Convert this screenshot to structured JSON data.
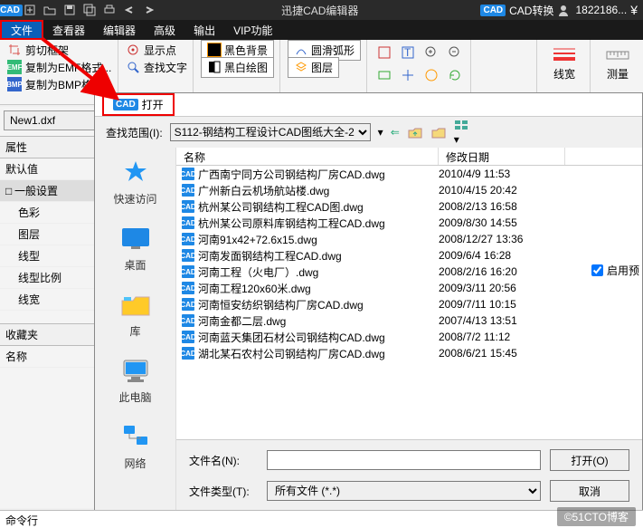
{
  "titlebar": {
    "app_name": "迅捷CAD编辑器",
    "convert_label": "CAD转换",
    "user": "1822186..."
  },
  "menubar": {
    "file": "文件",
    "viewer": "查看器",
    "editor": "编辑器",
    "advanced": "高级",
    "output": "输出",
    "vip": "VIP功能"
  },
  "ribbon": {
    "cut_frame": "剪切框架",
    "copy_emf": "复制为EMF格式...",
    "copy_bmp": "复制为BMP格式...",
    "show_point": "显示点",
    "find_text": "查找文字",
    "black_bg": "黑色背景",
    "bw_draw": "黑白绘图",
    "arc": "圆滑弧形",
    "layer": "图层",
    "linewidth": "线宽",
    "measure": "测量"
  },
  "doc_tab": "New1.dxf",
  "left_panel": {
    "props": "属性",
    "default": "默认值",
    "general": "一般设置",
    "color": "色彩",
    "layer": "图层",
    "linetype": "线型",
    "linescale": "线型比例",
    "lineweight": "线宽",
    "favorites": "收藏夹",
    "name": "名称"
  },
  "dialog": {
    "open": "打开",
    "lookin_label": "查找范围(I):",
    "lookin_value": "S112-钢结构工程设计CAD图纸大全-2",
    "col_name": "名称",
    "col_date": "修改日期",
    "places": {
      "quick": "快速访问",
      "desktop": "桌面",
      "library": "库",
      "thispc": "此电脑",
      "network": "网络"
    },
    "files": [
      {
        "name": "广西南宁同方公司钢结构厂房CAD.dwg",
        "date": "2010/4/9 11:53"
      },
      {
        "name": "广州新白云机场航站楼.dwg",
        "date": "2010/4/15 20:42"
      },
      {
        "name": "杭州某公司钢结构工程CAD图.dwg",
        "date": "2008/2/13 16:58"
      },
      {
        "name": "杭州某公司原料库钢结构工程CAD.dwg",
        "date": "2009/8/30 14:55"
      },
      {
        "name": "河南91x42+72.6x15.dwg",
        "date": "2008/12/27 13:36"
      },
      {
        "name": "河南发面钢结构工程CAD.dwg",
        "date": "2009/6/4 16:28"
      },
      {
        "name": "河南工程（火电厂）.dwg",
        "date": "2008/2/16 16:20"
      },
      {
        "name": "河南工程120x60米.dwg",
        "date": "2009/3/11 20:56"
      },
      {
        "name": "河南恒安纺织钢结构厂房CAD.dwg",
        "date": "2009/7/11 10:15"
      },
      {
        "name": "河南金都二层.dwg",
        "date": "2007/4/13 13:51"
      },
      {
        "name": "河南蓝天集团石材公司钢结构CAD.dwg",
        "date": "2008/7/2 11:12"
      },
      {
        "name": "湖北某石农村公司钢结构厂房CAD.dwg",
        "date": "2008/6/21 15:45"
      }
    ],
    "filename_label": "文件名(N):",
    "filename_value": "",
    "filetype_label": "文件类型(T):",
    "filetype_value": "所有文件 (*.*)",
    "open_btn": "打开(O)",
    "cancel_btn": "取消"
  },
  "right": {
    "enable_preview": "启用预"
  },
  "cmd": "命令行",
  "watermark": "©51CTO博客"
}
